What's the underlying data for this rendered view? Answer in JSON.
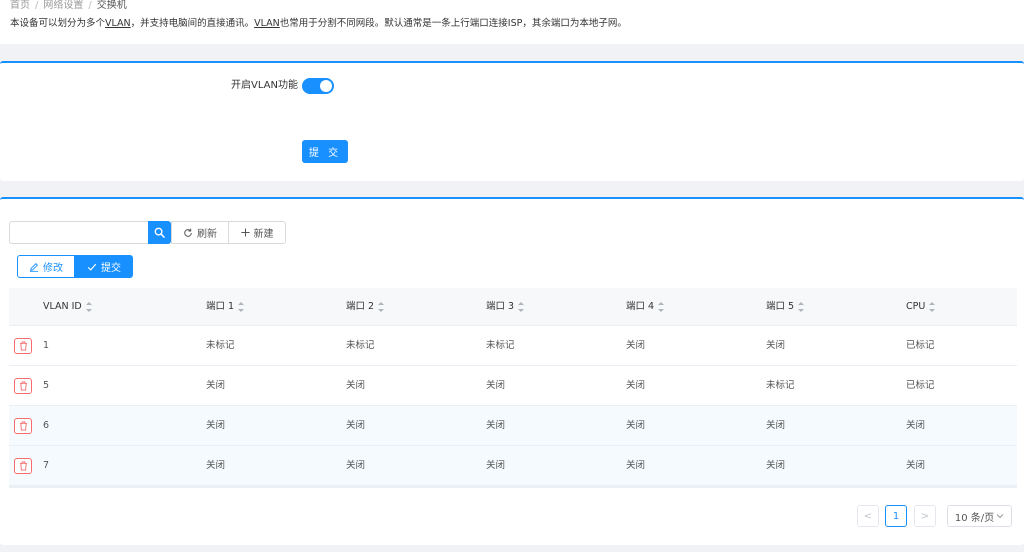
{
  "breadcrumb": {
    "home": "首页",
    "network": "网络设置",
    "current": "交换机"
  },
  "description": {
    "part1": "本设备可以划分为多个",
    "vlan1": "VLAN",
    "part2": "，并支持电脑间的直接通讯。",
    "vlan2": "VLAN",
    "part3": "也常用于分割不同网段。默认通常是一条上行端口连接ISP，其余端口为本地子网。"
  },
  "vlan_form": {
    "enable_label": "开启VLAN功能",
    "enabled": true,
    "submit_label": "提 交"
  },
  "toolbar": {
    "search_placeholder": "",
    "refresh_label": "刷新",
    "new_label": "新建",
    "edit_label": "修改",
    "commit_label": "提交"
  },
  "table": {
    "columns": [
      "VLAN ID",
      "端口 1",
      "端口 2",
      "端口 3",
      "端口 4",
      "端口 5",
      "CPU"
    ],
    "rows": [
      [
        "1",
        "未标记",
        "未标记",
        "未标记",
        "关闭",
        "关闭",
        "已标记"
      ],
      [
        "5",
        "关闭",
        "关闭",
        "关闭",
        "关闭",
        "未标记",
        "已标记"
      ],
      [
        "6",
        "关闭",
        "关闭",
        "关闭",
        "关闭",
        "关闭",
        "关闭"
      ],
      [
        "7",
        "关闭",
        "关闭",
        "关闭",
        "关闭",
        "关闭",
        "关闭"
      ]
    ]
  },
  "pagination": {
    "prev": "<",
    "next": ">",
    "current_page": "1",
    "page_size": "10 条/页"
  },
  "colors": {
    "primary": "#1890ff",
    "danger": "#f56c6c",
    "background": "#f0f2f5"
  },
  "icons": {
    "search": "search-icon",
    "refresh": "refresh-icon",
    "new": "plus-icon",
    "edit": "edit-icon",
    "commit": "check-icon",
    "delete": "trash-icon",
    "page_size": "chevron-down-icon"
  }
}
